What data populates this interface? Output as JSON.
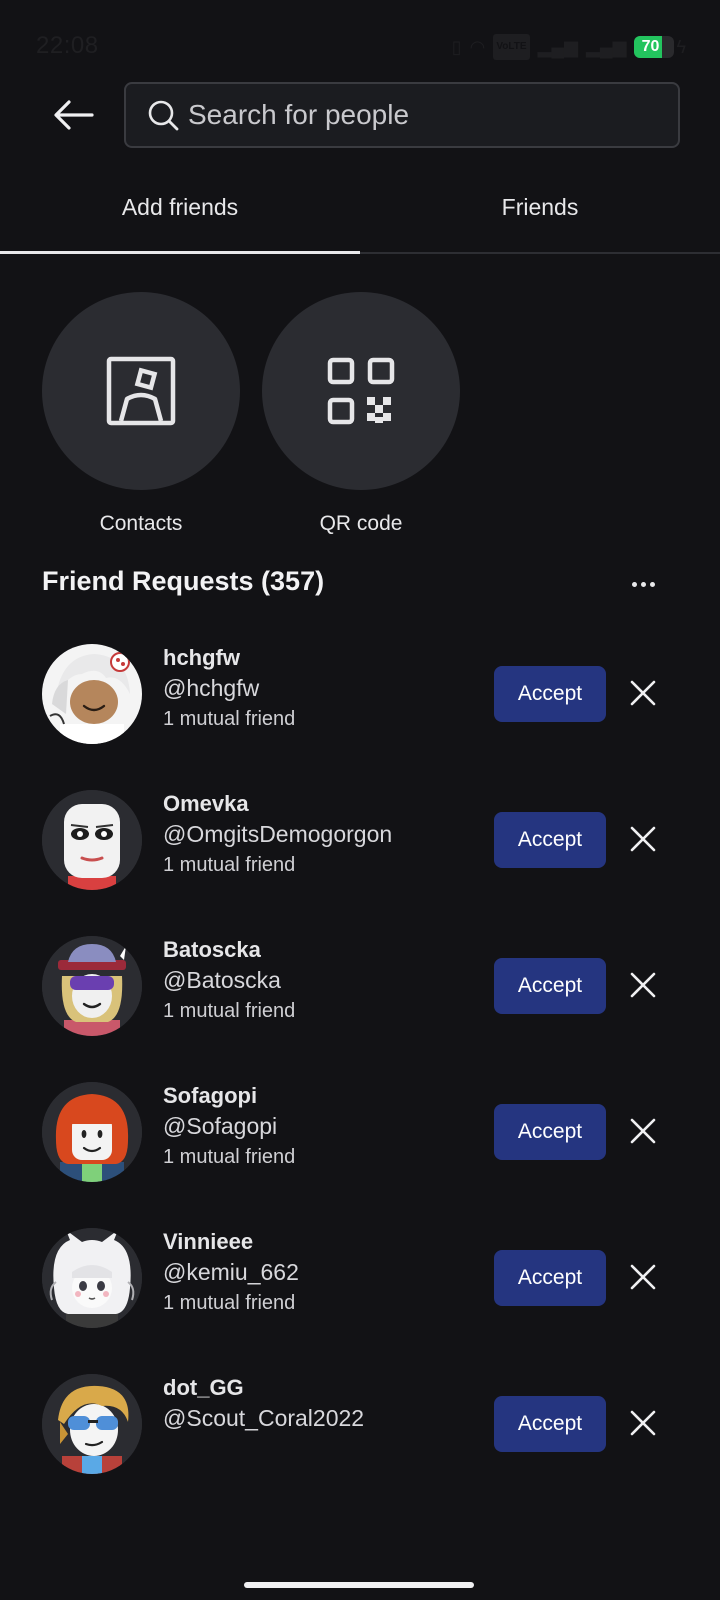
{
  "status_bar": {
    "time": "22:08",
    "battery_level": 70,
    "battery_text": "70",
    "volte_text": "VoLTE"
  },
  "search": {
    "placeholder": "Search for people"
  },
  "tabs": [
    {
      "label": "Add friends",
      "active": true
    },
    {
      "label": "Friends",
      "active": false
    }
  ],
  "quick_actions": [
    {
      "label": "Contacts",
      "icon": "contacts-icon"
    },
    {
      "label": "QR code",
      "icon": "qr-code-icon"
    }
  ],
  "requests": {
    "title": "Friend Requests (357)",
    "accept_label": "Accept",
    "items": [
      {
        "display_name": "hchgfw",
        "username": "@hchgfw",
        "mutual": "1 mutual friend"
      },
      {
        "display_name": "Omevka",
        "username": "@OmgitsDemogorgon",
        "mutual": "1 mutual friend"
      },
      {
        "display_name": "Batoscka",
        "username": "@Batoscka",
        "mutual": "1 mutual friend"
      },
      {
        "display_name": "Sofagopi",
        "username": "@Sofagopi",
        "mutual": "1 mutual friend"
      },
      {
        "display_name": "Vinnieee",
        "username": "@kemiu_662",
        "mutual": "1 mutual friend"
      },
      {
        "display_name": "dot_GG",
        "username": "@Scout_Coral2022",
        "mutual": ""
      }
    ]
  },
  "colors": {
    "background": "#121215",
    "accept_button": "#253580",
    "battery_fill": "#23c45e"
  }
}
